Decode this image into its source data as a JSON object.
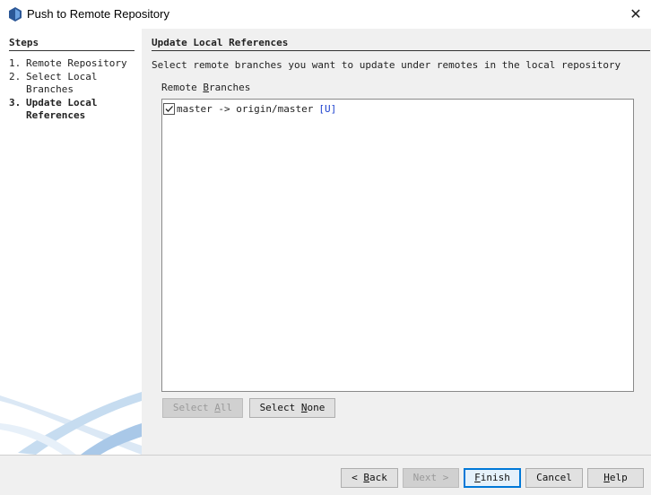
{
  "window": {
    "title": "Push to Remote Repository",
    "close_glyph": "✕",
    "icon": "netbeans-app-icon"
  },
  "steps": {
    "header": "Steps",
    "items": [
      {
        "num": "1.",
        "label": "Remote Repository",
        "current": false
      },
      {
        "num": "2.",
        "label": "Select Local Branches",
        "current": false
      },
      {
        "num": "3.",
        "label": "Update Local References",
        "current": true
      }
    ]
  },
  "panel": {
    "header": "Update Local References",
    "description": "Select remote branches you want to update under remotes in the local repository",
    "list_label_pre": "Remote ",
    "list_label_mnemonic": "B",
    "list_label_post": "ranches",
    "branches": [
      {
        "checked": true,
        "text": "master -> origin/master",
        "flag": "[U]"
      }
    ]
  },
  "buttons": {
    "select_all": {
      "pre": "Select ",
      "mn": "A",
      "post": "ll",
      "enabled": false
    },
    "select_none": {
      "pre": "Select ",
      "mn": "N",
      "post": "one",
      "enabled": true
    },
    "back": {
      "pre": "< ",
      "mn": "B",
      "post": "ack",
      "enabled": true
    },
    "next": {
      "label": "Next >",
      "enabled": false
    },
    "finish": {
      "pre": "",
      "mn": "F",
      "post": "inish",
      "enabled": true,
      "default": true
    },
    "cancel": {
      "label": "Cancel",
      "enabled": true
    },
    "help": {
      "pre": "",
      "mn": "H",
      "post": "elp",
      "enabled": true
    }
  },
  "colors": {
    "accent": "#0078d7",
    "flag": "#1a3fcf",
    "panel_bg": "#f0f0f0"
  }
}
